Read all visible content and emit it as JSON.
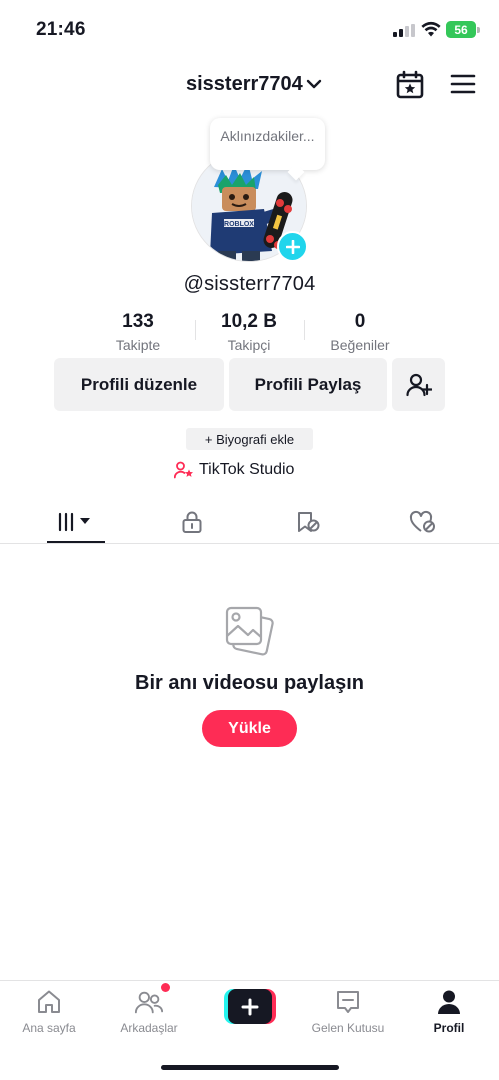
{
  "status_bar": {
    "time": "21:46",
    "battery_level": "56",
    "icons": [
      "signal-icon",
      "wifi-icon",
      "battery-icon"
    ]
  },
  "header": {
    "username": "sissterr7704",
    "icons": [
      "chevron-down-icon",
      "calendar-star-icon",
      "menu-icon"
    ]
  },
  "profile": {
    "tooltip": "Aklınızdakiler...",
    "handle": "@sissterr7704",
    "stats": [
      {
        "value": "133",
        "label": "Takipte"
      },
      {
        "value": "10,2 B",
        "label": "Takipçi"
      },
      {
        "value": "0",
        "label": "Beğeniler"
      }
    ],
    "buttons": {
      "edit": "Profili düzenle",
      "share": "Profili Paylaş"
    },
    "bio_chip": "+ Biyografi ekle",
    "studio_link": "TikTok Studio"
  },
  "tabs": [
    {
      "icon": "grid-icon",
      "active": true
    },
    {
      "icon": "lock-icon",
      "active": false
    },
    {
      "icon": "saved-icon",
      "active": false
    },
    {
      "icon": "liked-icon",
      "active": false
    }
  ],
  "empty_state": {
    "title": "Bir anı videosu paylaşın",
    "upload_label": "Yükle"
  },
  "bottom_nav": {
    "items": [
      {
        "label": "Ana sayfa",
        "icon": "home-icon"
      },
      {
        "label": "Arkadaşlar",
        "icon": "friends-icon"
      },
      {
        "label": "",
        "icon": "plus-icon"
      },
      {
        "label": "Gelen Kutusu",
        "icon": "inbox-icon"
      },
      {
        "label": "Profil",
        "icon": "profile-icon"
      }
    ]
  },
  "colors": {
    "accent": "#fe2c55",
    "cyan": "#20d5ec",
    "text": "#161823",
    "muted": "#73757d",
    "button_bg": "#f1f1f2"
  }
}
